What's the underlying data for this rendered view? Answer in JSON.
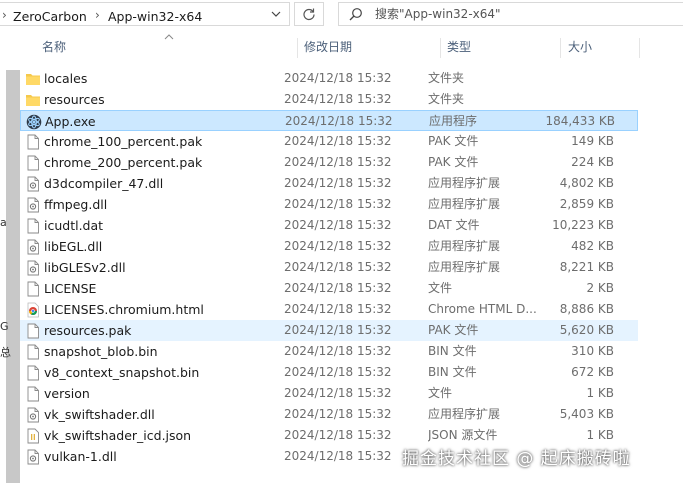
{
  "breadcrumb": {
    "items": [
      "ZeroCarbon",
      "App-win32-x64"
    ]
  },
  "search": {
    "placeholder": "搜索\"App-win32-x64\""
  },
  "nav_fragments": [
    "a",
    "G",
    "总"
  ],
  "columns": {
    "name": "名称",
    "date": "修改日期",
    "type": "类型",
    "size": "大小"
  },
  "files": [
    {
      "name": "locales",
      "date": "2024/12/18 15:32",
      "type": "文件夹",
      "size": "",
      "icon": "folder-icon"
    },
    {
      "name": "resources",
      "date": "2024/12/18 15:32",
      "type": "文件夹",
      "size": "",
      "icon": "folder-icon"
    },
    {
      "name": "App.exe",
      "date": "2024/12/18 15:32",
      "type": "应用程序",
      "size": "184,433 KB",
      "icon": "app-exe-icon",
      "selected": true
    },
    {
      "name": "chrome_100_percent.pak",
      "date": "2024/12/18 15:32",
      "type": "PAK 文件",
      "size": "149 KB",
      "icon": "file-icon"
    },
    {
      "name": "chrome_200_percent.pak",
      "date": "2024/12/18 15:32",
      "type": "PAK 文件",
      "size": "224 KB",
      "icon": "file-icon"
    },
    {
      "name": "d3dcompiler_47.dll",
      "date": "2024/12/18 15:32",
      "type": "应用程序扩展",
      "size": "4,802 KB",
      "icon": "dll-icon"
    },
    {
      "name": "ffmpeg.dll",
      "date": "2024/12/18 15:32",
      "type": "应用程序扩展",
      "size": "2,859 KB",
      "icon": "dll-icon"
    },
    {
      "name": "icudtl.dat",
      "date": "2024/12/18 15:32",
      "type": "DAT 文件",
      "size": "10,223 KB",
      "icon": "file-icon"
    },
    {
      "name": "libEGL.dll",
      "date": "2024/12/18 15:32",
      "type": "应用程序扩展",
      "size": "482 KB",
      "icon": "dll-icon"
    },
    {
      "name": "libGLESv2.dll",
      "date": "2024/12/18 15:32",
      "type": "应用程序扩展",
      "size": "8,221 KB",
      "icon": "dll-icon"
    },
    {
      "name": "LICENSE",
      "date": "2024/12/18 15:32",
      "type": "文件",
      "size": "2 KB",
      "icon": "file-icon"
    },
    {
      "name": "LICENSES.chromium.html",
      "date": "2024/12/18 15:32",
      "type": "Chrome HTML D...",
      "size": "8,886 KB",
      "icon": "chrome-icon"
    },
    {
      "name": "resources.pak",
      "date": "2024/12/18 15:32",
      "type": "PAK 文件",
      "size": "5,620 KB",
      "icon": "file-icon",
      "hover": true
    },
    {
      "name": "snapshot_blob.bin",
      "date": "2024/12/18 15:32",
      "type": "BIN 文件",
      "size": "310 KB",
      "icon": "file-icon"
    },
    {
      "name": "v8_context_snapshot.bin",
      "date": "2024/12/18 15:32",
      "type": "BIN 文件",
      "size": "672 KB",
      "icon": "file-icon"
    },
    {
      "name": "version",
      "date": "2024/12/18 15:32",
      "type": "文件",
      "size": "1 KB",
      "icon": "file-icon"
    },
    {
      "name": "vk_swiftshader.dll",
      "date": "2024/12/18 15:32",
      "type": "应用程序扩展",
      "size": "5,403 KB",
      "icon": "dll-icon"
    },
    {
      "name": "vk_swiftshader_icd.json",
      "date": "2024/12/18 15:32",
      "type": "JSON 源文件",
      "size": "1 KB",
      "icon": "json-icon"
    },
    {
      "name": "vulkan-1.dll",
      "date": "2024/12/18 15:32",
      "type": "",
      "size": "",
      "icon": "dll-icon"
    }
  ],
  "watermark": "掘金技术社区 @ 起床搬砖啦"
}
